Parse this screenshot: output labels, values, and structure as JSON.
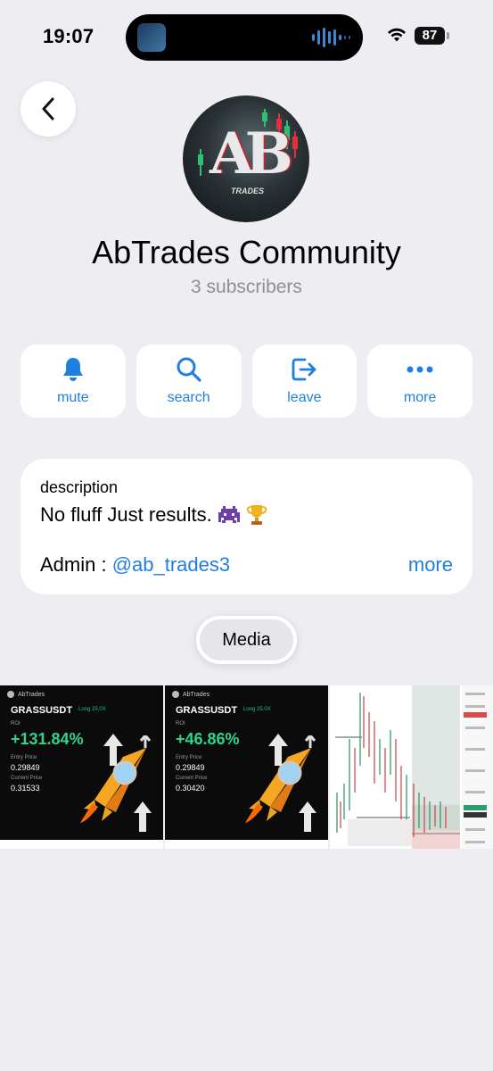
{
  "status_bar": {
    "time": "19:07",
    "battery": "87"
  },
  "channel": {
    "title": "AbTrades Community",
    "subscribers": "3 subscribers",
    "avatar_text": "AB",
    "avatar_sub": "TRADES"
  },
  "actions": [
    {
      "label": "mute",
      "icon": "bell-icon"
    },
    {
      "label": "search",
      "icon": "search-icon"
    },
    {
      "label": "leave",
      "icon": "leave-icon"
    },
    {
      "label": "more",
      "icon": "ellipsis-icon"
    }
  ],
  "description": {
    "label": "description",
    "text": "No fluff Just results.",
    "admin_prefix": "Admin : ",
    "admin_handle": "@ab_trades3",
    "more": "more"
  },
  "media_tab": "Media",
  "media": [
    {
      "brand": "AbTrades",
      "pair": "GRASSUSDT",
      "side": "Long 25.0X",
      "roi_label": "ROI",
      "roi": "+131.84%",
      "entry_label": "Entry Price",
      "entry": "0.29849",
      "current_label": "Current Price",
      "current": "0.31533"
    },
    {
      "brand": "AbTrades",
      "pair": "GRASSUSDT",
      "side": "Long 25.0X",
      "roi_label": "ROI",
      "roi": "+46.86%",
      "entry_label": "Entry Price",
      "entry": "0.29849",
      "current_label": "Current Price",
      "current": "0.30420"
    }
  ],
  "colors": {
    "accent": "#1f7fe0",
    "background": "#eeeef2",
    "card": "#ffffff",
    "secondary_text": "#8e8e93",
    "profit_green": "#2ed48a"
  }
}
